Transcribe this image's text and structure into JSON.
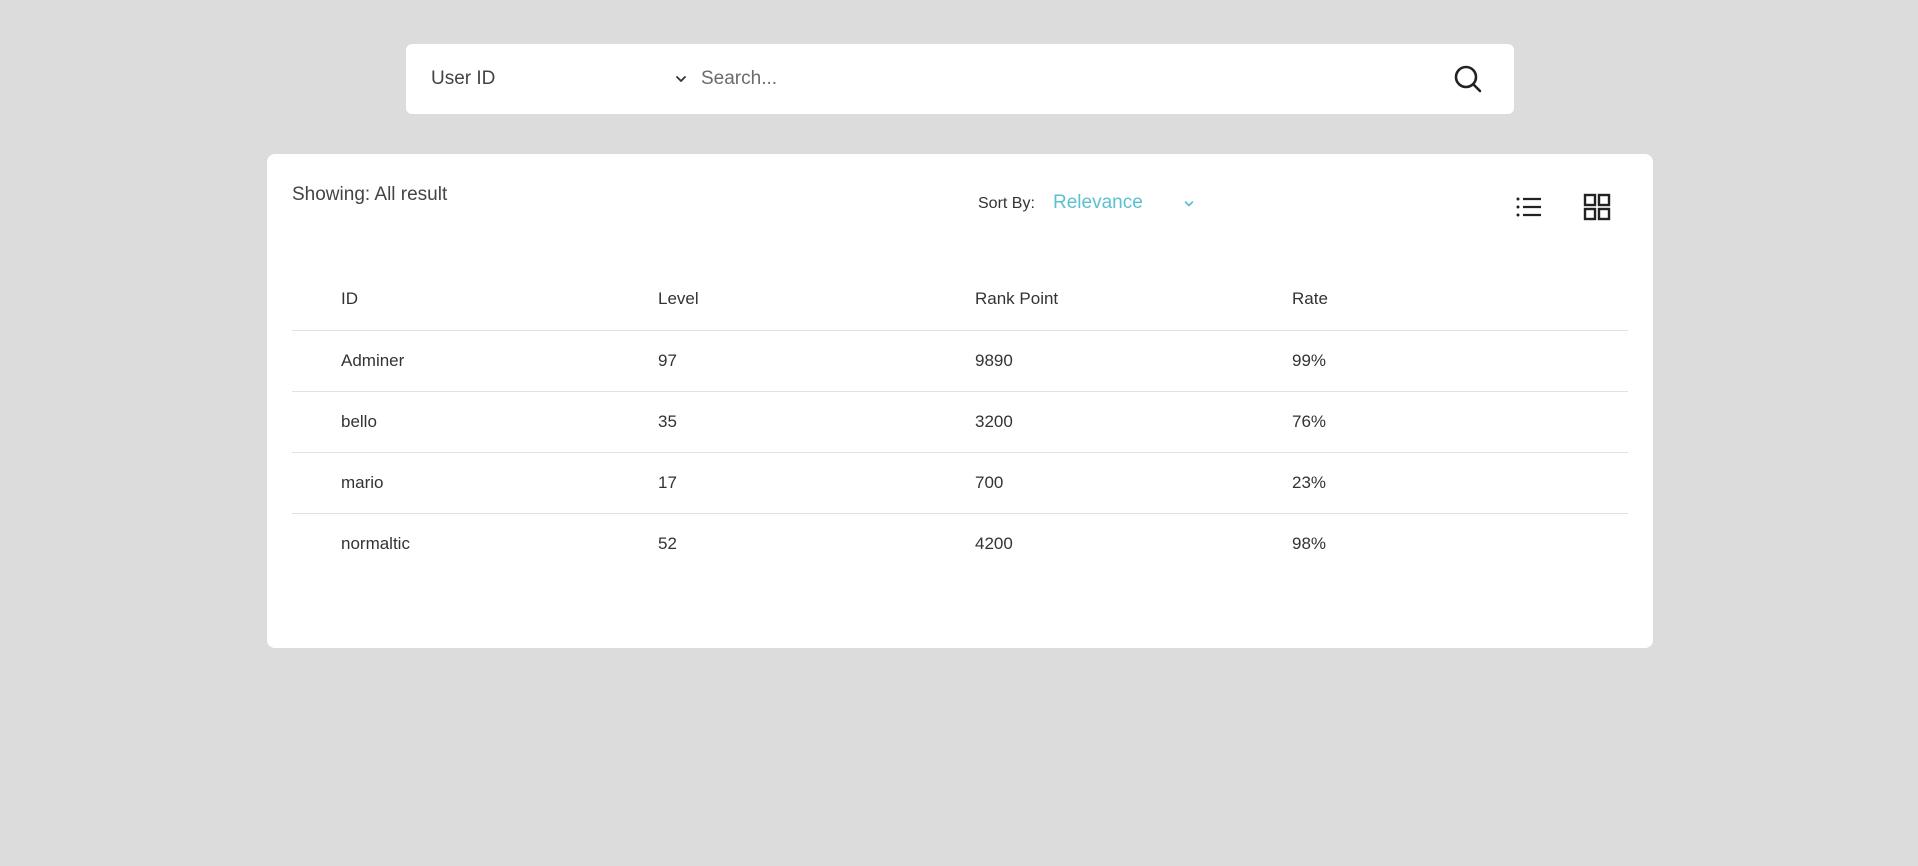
{
  "search": {
    "filter_value": "User ID",
    "placeholder": "Search...",
    "value": ""
  },
  "results": {
    "showing_text": "Showing: All result",
    "sort_label": "Sort By:",
    "sort_value": "Relevance",
    "columns": [
      "ID",
      "Level",
      "Rank Point",
      "Rate"
    ],
    "rows": [
      [
        "Adminer",
        "97",
        "9890",
        "99%"
      ],
      [
        "bello",
        "35",
        "3200",
        "76%"
      ],
      [
        "mario",
        "17",
        "700",
        "23%"
      ],
      [
        "normaltic",
        "52",
        "4200",
        "98%"
      ]
    ]
  },
  "icons": {
    "filter_chevron": "chevron-down-icon",
    "search": "search-icon",
    "sort_chevron": "chevron-down-icon",
    "list_view": "list-view-icon",
    "grid_view": "grid-view-icon"
  },
  "colors": {
    "background": "#dcdcdc",
    "panel": "#ffffff",
    "accent": "#5bc0d0",
    "text": "#333333",
    "divider": "#e2e2e2"
  }
}
